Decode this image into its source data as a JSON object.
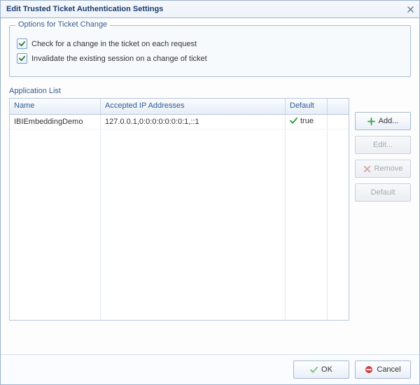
{
  "title": "Edit Trusted Ticket Authentication Settings",
  "group": {
    "legend": "Options for Ticket Change",
    "check1_label": "Check for a change in the ticket on each request",
    "check2_label": "Invalidate the existing session on a change of ticket"
  },
  "list": {
    "title": "Application List",
    "headers": {
      "name": "Name",
      "ip": "Accepted IP Addresses",
      "def": "Default"
    },
    "rows": [
      {
        "name": "IBIEmbeddingDemo",
        "ip": "127.0.0.1,0:0:0:0:0:0:0:1,::1",
        "def": "true"
      }
    ]
  },
  "side": {
    "add": "Add...",
    "edit": "Edit...",
    "remove": "Remove",
    "default": "Default"
  },
  "footer": {
    "ok": "OK",
    "cancel": "Cancel"
  }
}
